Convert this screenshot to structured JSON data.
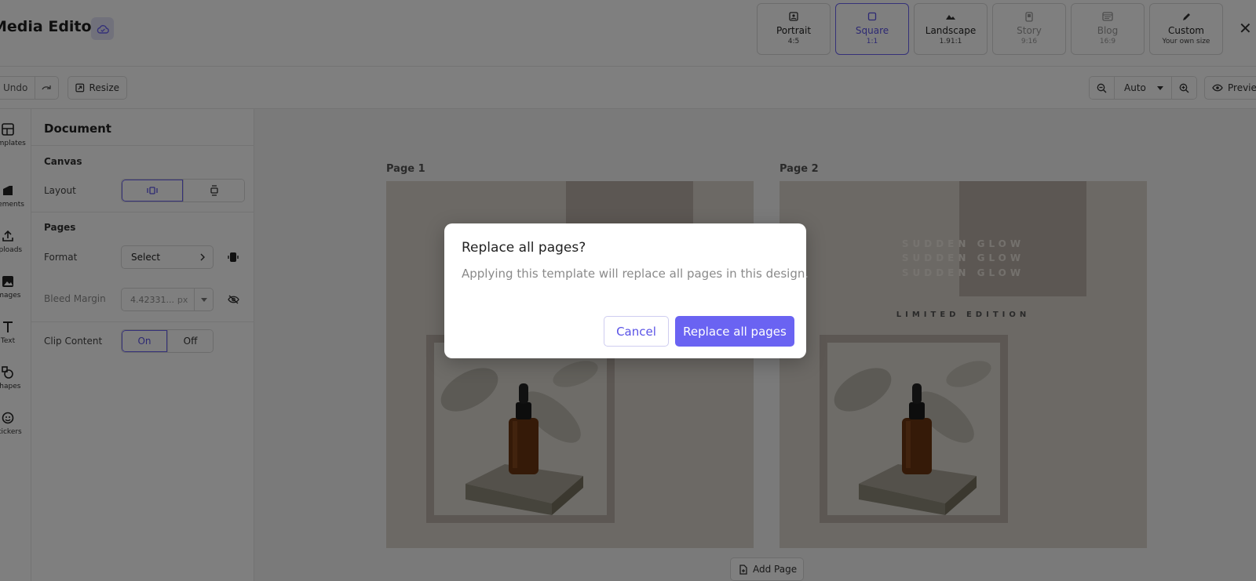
{
  "header": {
    "title": "Media Editor",
    "sizes": [
      {
        "label": "Portrait",
        "sub": "4:5"
      },
      {
        "label": "Square",
        "sub": "1:1"
      },
      {
        "label": "Landscape",
        "sub": "1.91:1"
      },
      {
        "label": "Story",
        "sub": "9:16"
      },
      {
        "label": "Blog",
        "sub": "16:9"
      },
      {
        "label": "Custom",
        "sub": "Your own size"
      }
    ],
    "close": "✕"
  },
  "toolbar": {
    "undo": "Undo",
    "resize": "Resize",
    "zoom": "Auto",
    "preview": "Preview"
  },
  "rail": [
    "Templates",
    "Elements",
    "Uploads",
    "Images",
    "Text",
    "Shapes",
    "Stickers"
  ],
  "panel": {
    "title": "Document",
    "canvas_section": "Canvas",
    "layout_label": "Layout",
    "pages_section": "Pages",
    "format_label": "Format",
    "format_value": "Select",
    "bleed_label": "Bleed Margin",
    "bleed_value": "4.42331...",
    "bleed_unit": "px",
    "clip_label": "Clip Content",
    "clip_on": "On",
    "clip_off": "Off"
  },
  "canvas": {
    "page1": "Page 1",
    "page2": "Page 2",
    "glow_word1": "SUDDEN",
    "glow_word2": "GLOW",
    "limited": "LIMITED EDITION",
    "add_page": "Add Page"
  },
  "modal": {
    "title": "Replace all pages?",
    "text": "Applying this template will replace all pages in this design.",
    "cancel": "Cancel",
    "confirm": "Replace all pages"
  },
  "colors": {
    "accent": "#6a63f2",
    "page_bg": "#d9d3cb",
    "block": "#b9afa6"
  }
}
